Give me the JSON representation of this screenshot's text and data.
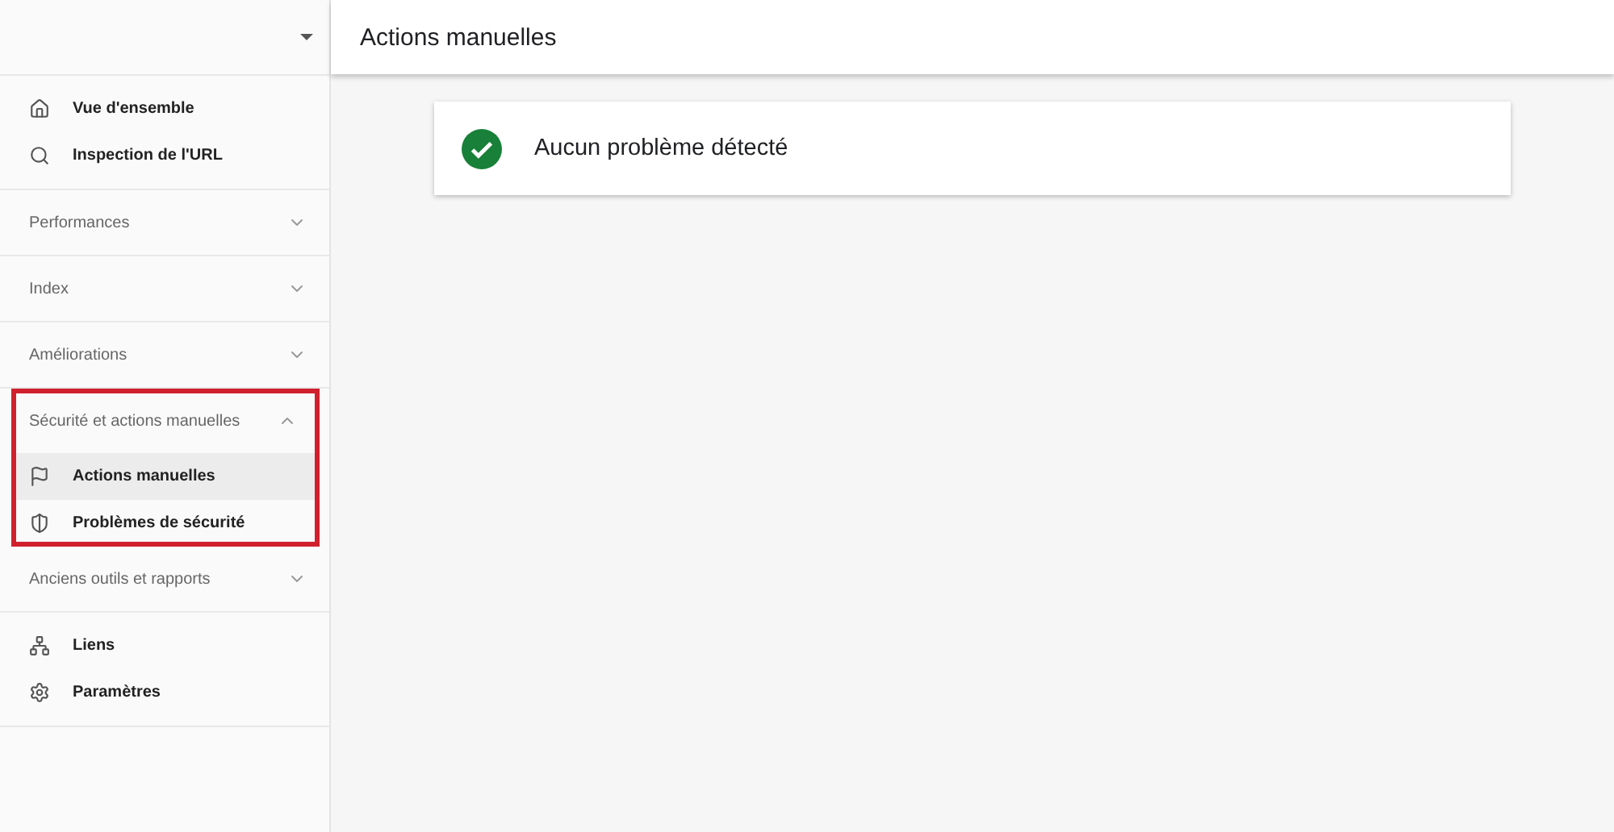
{
  "sidebar": {
    "groups": [
      {
        "kind": "links",
        "items": [
          {
            "label": "Vue d'ensemble",
            "selected": false
          },
          {
            "label": "Inspection de l'URL",
            "selected": false
          }
        ]
      },
      {
        "kind": "section",
        "title": "Performances",
        "expanded": false,
        "highlighted": false
      },
      {
        "kind": "section",
        "title": "Index",
        "expanded": false,
        "highlighted": false
      },
      {
        "kind": "section",
        "title": "Améliorations",
        "expanded": false,
        "highlighted": false
      },
      {
        "kind": "section",
        "title": "Sécurité et actions manuelles",
        "expanded": true,
        "highlighted": true,
        "items": [
          {
            "label": "Actions manuelles",
            "selected": true
          },
          {
            "label": "Problèmes de sécurité",
            "selected": false
          }
        ]
      },
      {
        "kind": "section",
        "title": "Anciens outils et rapports",
        "expanded": false,
        "highlighted": false
      },
      {
        "kind": "links",
        "items": [
          {
            "label": "Liens",
            "selected": false
          },
          {
            "label": "Paramètres",
            "selected": false
          }
        ]
      }
    ]
  },
  "page": {
    "title": "Actions manuelles"
  },
  "status_card": {
    "message": "Aucun problème détecté"
  }
}
